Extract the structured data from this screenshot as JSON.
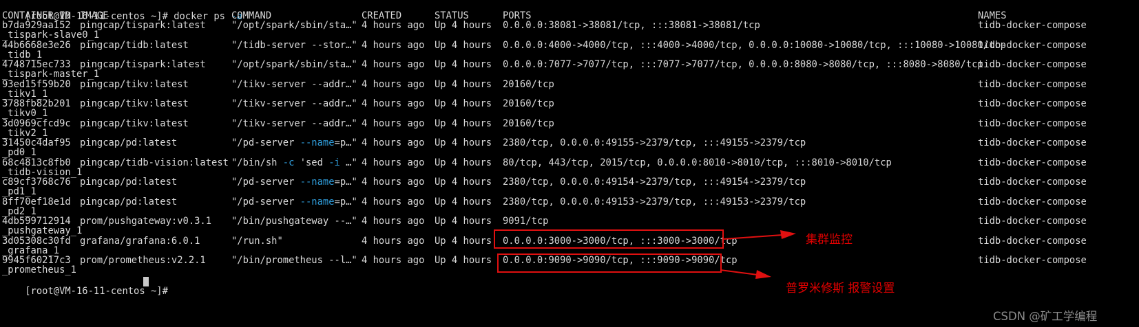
{
  "terminal": {
    "prompt": "[root@VM-16-11-centos ~]# ",
    "command_parts": [
      "docker ps ",
      "-a"
    ],
    "headers": {
      "id": "CONTAINER ID",
      "image": "IMAGE",
      "command": "COMMAND",
      "created": "CREATED",
      "status": "STATUS",
      "ports": "PORTS",
      "names": "NAMES"
    },
    "rows": [
      {
        "id": "b7da929aa152",
        "image": "pingcap/tispark:latest",
        "command": [
          "\"/opt/spark/sbin/sta…\""
        ],
        "created": "4 hours ago",
        "status": "Up 4 hours",
        "ports": "0.0.0.0:38081->38081/tcp, :::38081->38081/tcp",
        "name": "tidb-docker-compose",
        "name_cont": "_tispark-slave0_1"
      },
      {
        "id": "44b6668e3e26",
        "image": "pingcap/tidb:latest",
        "command": [
          "\"/tidb-server --stor…\""
        ],
        "created": "4 hours ago",
        "status": "Up 4 hours",
        "ports": "0.0.0.0:4000->4000/tcp, :::4000->4000/tcp, 0.0.0.0:10080->10080/tcp, :::10080->10080/tcp",
        "name": "tidb-docker-compose",
        "name_cont": "_tidb_1"
      },
      {
        "id": "4748715ec733",
        "image": "pingcap/tispark:latest",
        "command": [
          "\"/opt/spark/sbin/sta…\""
        ],
        "created": "4 hours ago",
        "status": "Up 4 hours",
        "ports": "0.0.0.0:7077->7077/tcp, :::7077->7077/tcp, 0.0.0.0:8080->8080/tcp, :::8080->8080/tcp",
        "name": "tidb-docker-compose",
        "name_cont": "_tispark-master_1"
      },
      {
        "id": "93ed15f59b20",
        "image": "pingcap/tikv:latest",
        "command": [
          "\"/tikv-server --addr…\""
        ],
        "created": "4 hours ago",
        "status": "Up 4 hours",
        "ports": "20160/tcp",
        "name": "tidb-docker-compose",
        "name_cont": "_tikv1_1"
      },
      {
        "id": "3788fb82b201",
        "image": "pingcap/tikv:latest",
        "command": [
          "\"/tikv-server --addr…\""
        ],
        "created": "4 hours ago",
        "status": "Up 4 hours",
        "ports": "20160/tcp",
        "name": "tidb-docker-compose",
        "name_cont": "_tikv0_1"
      },
      {
        "id": "3d0969cfcd9c",
        "image": "pingcap/tikv:latest",
        "command": [
          "\"/tikv-server --addr…\""
        ],
        "created": "4 hours ago",
        "status": "Up 4 hours",
        "ports": "20160/tcp",
        "name": "tidb-docker-compose",
        "name_cont": "_tikv2_1"
      },
      {
        "id": "31450c4daf95",
        "image": "pingcap/pd:latest",
        "command": [
          "\"/pd-server ",
          "--name",
          "=p…\""
        ],
        "created": "4 hours ago",
        "status": "Up 4 hours",
        "ports": "2380/tcp, 0.0.0.0:49155->2379/tcp, :::49155->2379/tcp",
        "name": "tidb-docker-compose",
        "name_cont": "_pd0_1"
      },
      {
        "id": "68c4813c8fb0",
        "image": "pingcap/tidb-vision:latest",
        "command": [
          "\"/bin/sh ",
          "-c",
          " 'sed ",
          "-i",
          " …\""
        ],
        "created": "4 hours ago",
        "status": "Up 4 hours",
        "ports": "80/tcp, 443/tcp, 2015/tcp, 0.0.0.0:8010->8010/tcp, :::8010->8010/tcp",
        "name": "tidb-docker-compose",
        "name_cont": "_tidb-vision_1"
      },
      {
        "id": "c89cf3768c76",
        "image": "pingcap/pd:latest",
        "command": [
          "\"/pd-server ",
          "--name",
          "=p…\""
        ],
        "created": "4 hours ago",
        "status": "Up 4 hours",
        "ports": "2380/tcp, 0.0.0.0:49154->2379/tcp, :::49154->2379/tcp",
        "name": "tidb-docker-compose",
        "name_cont": "_pd1_1"
      },
      {
        "id": "8ff70ef18e1d",
        "image": "pingcap/pd:latest",
        "command": [
          "\"/pd-server ",
          "--name",
          "=p…\""
        ],
        "created": "4 hours ago",
        "status": "Up 4 hours",
        "ports": "2380/tcp, 0.0.0.0:49153->2379/tcp, :::49153->2379/tcp",
        "name": "tidb-docker-compose",
        "name_cont": "_pd2_1"
      },
      {
        "id": "4db599712914",
        "image": "prom/pushgateway:v0.3.1",
        "command": [
          "\"/bin/pushgateway --…\""
        ],
        "created": "4 hours ago",
        "status": "Up 4 hours",
        "ports": "9091/tcp",
        "name": "tidb-docker-compose",
        "name_cont": "_pushgateway_1"
      },
      {
        "id": "3d05308c30fd",
        "image": "grafana/grafana:6.0.1",
        "command": [
          "\"/run.sh\""
        ],
        "created": "4 hours ago",
        "status": "Up 4 hours",
        "ports": "0.0.0.0:3000->3000/tcp, :::3000->3000/tcp",
        "name": "tidb-docker-compose",
        "name_cont": "_grafana_1"
      },
      {
        "id": "9945f60217c3",
        "image": "prom/prometheus:v2.2.1",
        "command": [
          "\"/bin/prometheus --l…\""
        ],
        "created": "4 hours ago",
        "status": "Up 4 hours",
        "ports": "0.0.0.0:9090->9090/tcp, :::9090->9090/tcp",
        "name": "tidb-docker-compose",
        "name_cont": "_prometheus_1"
      }
    ],
    "final_prompt": "[root@VM-16-11-centos ~]# "
  },
  "annotations": {
    "grafana_label": "集群监控",
    "prometheus_label": "普罗米修斯 报警设置",
    "color": "#e01010"
  },
  "watermark": "CSDN @矿工学编程",
  "colors": {
    "background": "#000000",
    "text": "#d9d9d9",
    "flag": "#2f9bd8"
  }
}
